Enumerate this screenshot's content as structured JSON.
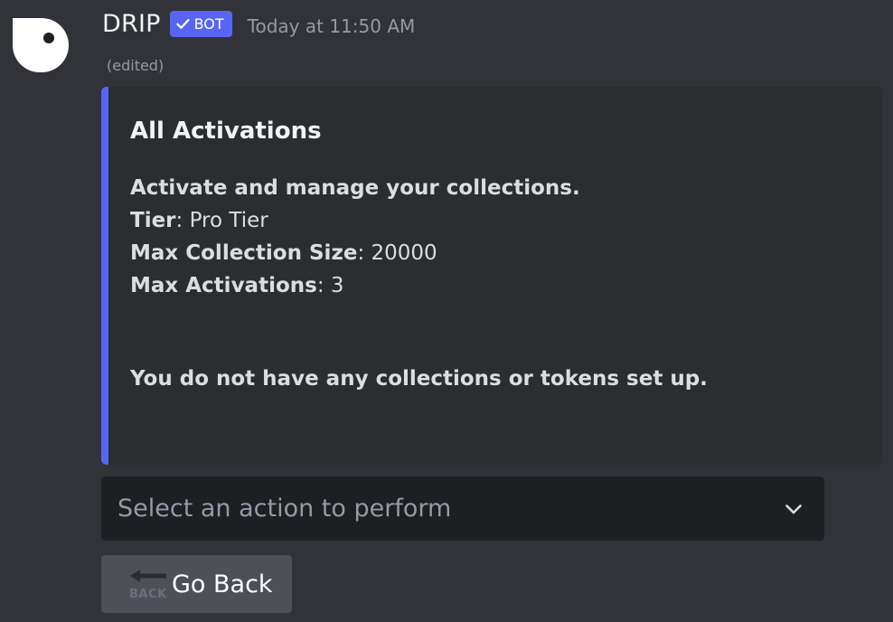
{
  "message": {
    "author": "DRIP",
    "bot_tag": "BOT",
    "timestamp": "Today at 11:50 AM",
    "edited_label": "(edited)"
  },
  "embed": {
    "accent_color": "#5865f2",
    "title": "All Activations",
    "subtitle": "Activate and manage your collections.",
    "fields": [
      {
        "label": "Tier",
        "separator": ": ",
        "value": "Pro Tier"
      },
      {
        "label": "Max Collection Size",
        "separator": ": ",
        "value": "20000"
      },
      {
        "label": "Max Activations",
        "separator": ": ",
        "value": "3"
      }
    ],
    "notice": "You do not have any collections or tokens set up."
  },
  "select_menu": {
    "placeholder": "Select an action to perform",
    "icon": "chevron-down-icon"
  },
  "go_back_button": {
    "emoji_text": "BACK",
    "icon": "back-arrow-icon",
    "label": "Go Back"
  },
  "colors": {
    "background": "#313338",
    "embed_background": "#2b2d31",
    "bot_tag": "#5865f2",
    "select_background": "#1e1f22",
    "button_background": "#4e5058"
  }
}
